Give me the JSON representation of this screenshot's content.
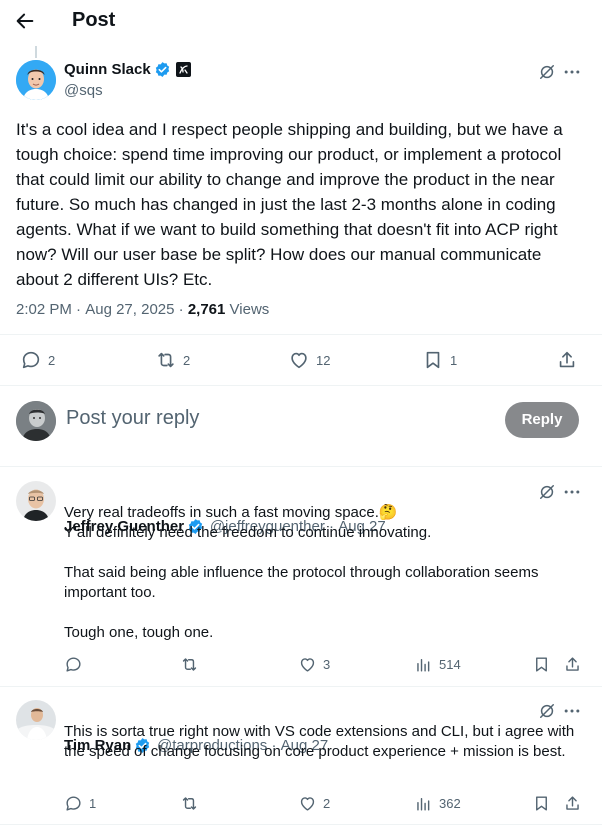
{
  "header": {
    "title": "Post"
  },
  "main_post": {
    "author_name": "Quinn Slack",
    "author_handle": "@sqs",
    "text": "It's a cool idea and I respect people shipping and building, but we have a tough choice: spend time improving our product, or implement a protocol that could limit our ability to change and improve the product in the near future. So much has changed in just the last 2-3 months alone in coding agents. What if we want to build something that doesn't fit into ACP right now? Will our user base be split? How does our manual communicate about 2 different UIs? Etc.",
    "time": "2:02 PM",
    "date": "Aug 27, 2025",
    "views_count": "2,761",
    "views_label": "Views",
    "replies": "2",
    "reposts": "2",
    "likes": "12",
    "bookmarks": "1"
  },
  "composer": {
    "placeholder": "Post your reply",
    "button_label": "Reply"
  },
  "replies": [
    {
      "name": "Jeffrey Guenther",
      "handle": "@jeffreyguenther",
      "date": "Aug 27",
      "text": "Very real tradeoffs in such a fast moving space.🤔\nY'all definitely need the freedom to continue innovating.\n\nThat said being able influence the protocol through collaboration seems important too.\n\nTough one, tough one.",
      "replies": "",
      "reposts": "",
      "likes": "3",
      "views": "514"
    },
    {
      "name": "Tim Ryan",
      "handle": "@tarproductions",
      "date": "Aug 27",
      "text": "This is sorta true right now with VS code extensions and CLI, but i agree with the speed of change focusing on core product experience + mission is best.",
      "replies": "1",
      "reposts": "",
      "likes": "2",
      "views": "362"
    }
  ],
  "colors": {
    "verified": "#1d9bf0",
    "reply_button": "#87898c",
    "text": "#0f1419",
    "muted": "#536471"
  },
  "icons": [
    "back-arrow-icon",
    "verified-icon",
    "affiliate-badge-icon",
    "grok-icon",
    "more-icon",
    "reply-icon",
    "repost-icon",
    "like-icon",
    "bookmark-icon",
    "share-icon",
    "views-icon"
  ]
}
